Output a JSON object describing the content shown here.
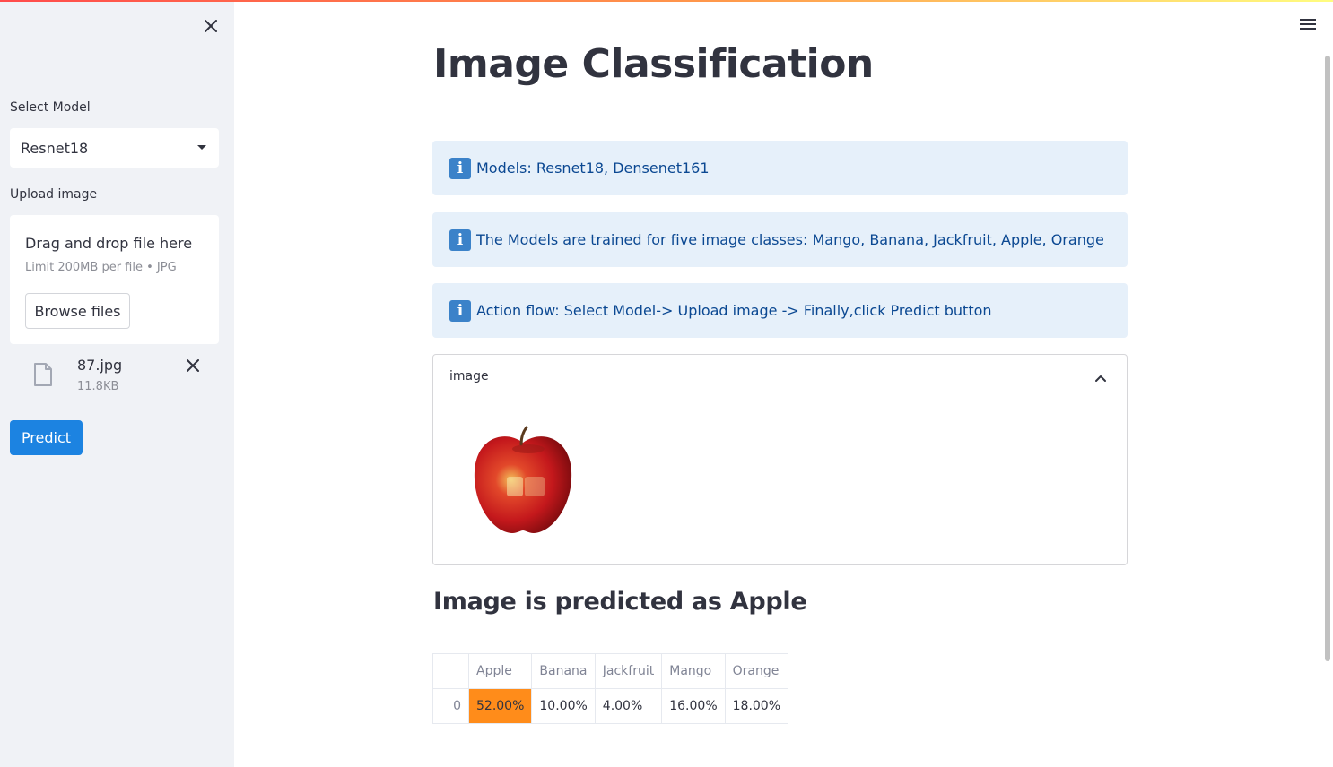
{
  "sidebar": {
    "select_label": "Select Model",
    "select_value": "Resnet18",
    "upload_label": "Upload image",
    "dropzone_title": "Drag and drop file here",
    "dropzone_limit": "Limit 200MB per file • JPG",
    "browse_label": "Browse files",
    "file_name": "87.jpg",
    "file_size": "11.8KB",
    "predict_label": "Predict"
  },
  "main": {
    "title": "Image Classification",
    "info": [
      "Models: Resnet18, Densenet161",
      "The Models are trained for five image classes: Mango, Banana, Jackfruit, Apple, Orange",
      "Action flow: Select Model-> Upload image -> Finally,click Predict button"
    ],
    "expander_label": "image",
    "prediction": "Image is predicted as Apple",
    "table": {
      "columns": [
        "Apple",
        "Banana",
        "Jackfruit",
        "Mango",
        "Orange"
      ],
      "row_index": "0",
      "values": [
        "52.00%",
        "10.00%",
        "4.00%",
        "16.00%",
        "18.00%"
      ],
      "highlight_color": "#ff8c1a"
    }
  },
  "colors": {
    "accent": "#1c83e1",
    "info_bg": "#e6f0fa",
    "info_text": "#0b4892",
    "sidebar_bg": "#f0f2f6"
  }
}
